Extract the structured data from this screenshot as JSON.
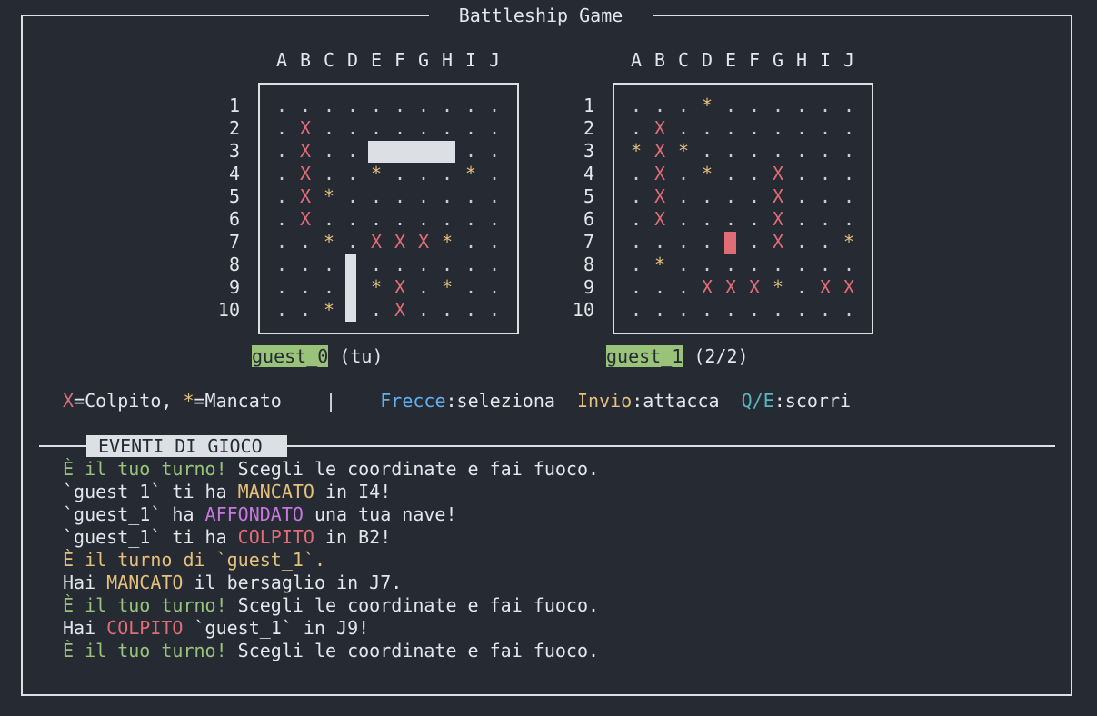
{
  "window": {
    "title": "Battleship Game"
  },
  "columns": [
    "A",
    "B",
    "C",
    "D",
    "E",
    "F",
    "G",
    "H",
    "I",
    "J"
  ],
  "rows": [
    "1",
    "2",
    "3",
    "4",
    "5",
    "6",
    "7",
    "8",
    "9",
    "10"
  ],
  "boards": [
    {
      "owner": "guest_0",
      "suffix": "(tu)",
      "grid": [
        "..........",
        ".X........",
        ".X........",
        ".X..*...*.",
        ".X*.......",
        ".X........",
        "..*.XXX*..",
        "..........",
        "....*X.*..",
        "..*..X...."
      ],
      "ships": [
        {
          "orientation": "horizontal",
          "cells": [
            "E3",
            "F3",
            "G3",
            "H3"
          ]
        },
        {
          "orientation": "vertical",
          "cells": [
            "D8",
            "D9",
            "D10"
          ]
        }
      ]
    },
    {
      "owner": "guest_1",
      "suffix": "(2/2)",
      "grid": [
        "...*......",
        ".X........",
        "*X*.......",
        ".X.*..X...",
        ".X....X...",
        ".X....X...",
        "......X..*",
        ".*........",
        "...XXX*.XX",
        ".........."
      ],
      "cursor": "E7"
    }
  ],
  "legend": {
    "hit_symbol": "X",
    "hit_text": "=Colpito, ",
    "miss_symbol": "*",
    "miss_text": "=Mancato",
    "separator": "|",
    "key1": "Frecce",
    "key1_text": ":seleziona",
    "key2": "Invio",
    "key2_text": ":attacca",
    "key3": "Q/E",
    "key3_text": ":scorri"
  },
  "events": {
    "title": "EVENTI DI GIOCO",
    "lines": [
      [
        {
          "t": "È il tuo turno!",
          "c": "green"
        },
        {
          "t": " Scegli le coordinate e fai fuoco.",
          "c": ""
        }
      ],
      [
        {
          "t": "`guest_1` ti ha ",
          "c": ""
        },
        {
          "t": "MANCATO",
          "c": "yellow"
        },
        {
          "t": " in I4!",
          "c": ""
        }
      ],
      [
        {
          "t": "`guest_1` ha ",
          "c": ""
        },
        {
          "t": "AFFONDATO",
          "c": "purple"
        },
        {
          "t": " una tua nave!",
          "c": ""
        }
      ],
      [
        {
          "t": "`guest_1` ti ha ",
          "c": ""
        },
        {
          "t": "COLPITO",
          "c": "red"
        },
        {
          "t": " in B2!",
          "c": ""
        }
      ],
      [
        {
          "t": "È il turno di `guest_1`.",
          "c": "yellow"
        }
      ],
      [
        {
          "t": "Hai ",
          "c": ""
        },
        {
          "t": "MANCATO",
          "c": "yellow"
        },
        {
          "t": " il bersaglio in J7.",
          "c": ""
        }
      ],
      [
        {
          "t": "È il tuo turno!",
          "c": "green"
        },
        {
          "t": " Scegli le coordinate e fai fuoco.",
          "c": ""
        }
      ],
      [
        {
          "t": "Hai ",
          "c": ""
        },
        {
          "t": "COLPITO",
          "c": "red"
        },
        {
          "t": " `guest_1` in J9!",
          "c": ""
        }
      ],
      [
        {
          "t": "È il tuo turno!",
          "c": "green"
        },
        {
          "t": " Scegli le coordinate e fai fuoco.",
          "c": ""
        }
      ]
    ]
  },
  "colors": {
    "background": "#262a33",
    "hit": "#e06c75",
    "miss": "#e5c07b",
    "player": "#98c379",
    "sunk": "#c678dd",
    "key_blue": "#61afef",
    "key_cyan": "#56b6c2"
  }
}
